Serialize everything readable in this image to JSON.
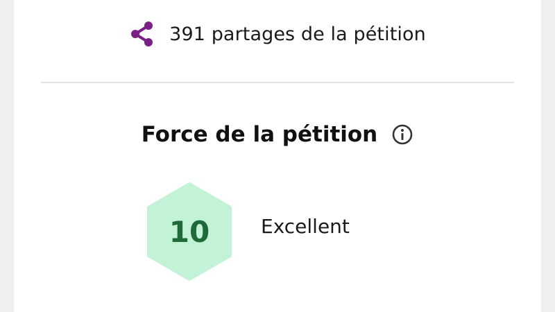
{
  "share": {
    "icon": "share-icon",
    "text": "391 partages de la pétition",
    "icon_color": "#7a1f86"
  },
  "strength": {
    "title": "Force de la pétition",
    "info_icon": "info-icon",
    "score": "10",
    "rating": "Excellent",
    "hex_color": "#c2f3d7",
    "score_color": "#1e6b39"
  }
}
